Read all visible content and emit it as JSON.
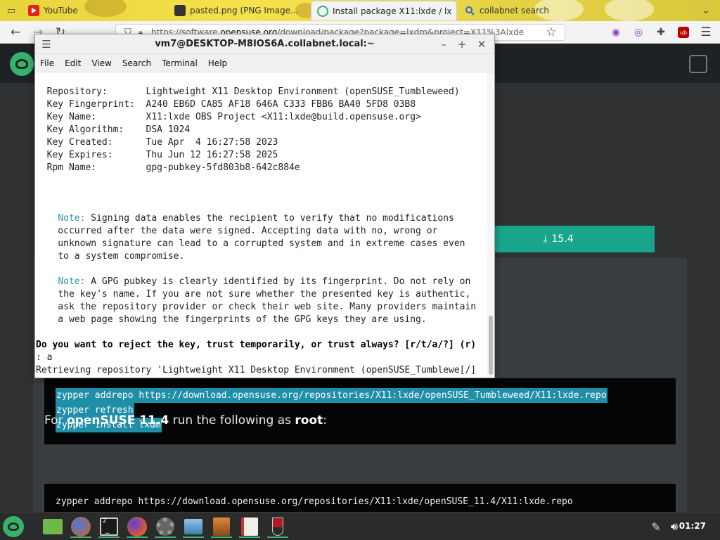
{
  "browser": {
    "tabs": [
      {
        "label": "YouTube",
        "icon": "youtube-icon"
      },
      {
        "label": "pasted.png (PNG Image...",
        "icon": "image-icon"
      },
      {
        "label": "Install package X11:lxde / lx",
        "icon": "opensuse-icon"
      },
      {
        "label": "collabnet search",
        "icon": "search-icon"
      }
    ],
    "url_prefix": "https://software.",
    "url_domain": "opensuse.org",
    "url_rest": "/download/package?package=lxdm&project=X11%3Alxde"
  },
  "site": {
    "download_label": "15.4",
    "code1": [
      "zypper addrepo https://download.opensuse.org/repositories/X11:lxde/openSUSE_Tumbleweed/X11:lxde.repo",
      "zypper refresh",
      "zypper install lxdm"
    ],
    "for_text_1": "For ",
    "for_text_2": "openSUSE 11.4",
    "for_text_3": " run the following as ",
    "for_text_4": "root",
    "for_text_5": ":",
    "code2": "zypper addrepo https://download.opensuse.org/repositories/X11:lxde/openSUSE_11.4/X11:lxde.repo"
  },
  "terminal": {
    "title": "vm7@DESKTOP-M8IOS6A.collabnet.local:~",
    "menu": [
      "File",
      "Edit",
      "View",
      "Search",
      "Terminal",
      "Help"
    ],
    "lines": {
      "l1": "  Repository:       Lightweight X11 Desktop Environment (openSUSE_Tumbleweed)",
      "l2": "  Key Fingerprint:  A240 EB6D CA85 AF18 646A C333 FBB6 BA40 5FD8 03B8",
      "l3": "  Key Name:         X11:lxde OBS Project <X11:lxde@build.opensuse.org>",
      "l4": "  Key Algorithm:    DSA 1024",
      "l5": "  Key Created:      Tue Apr  4 16:27:58 2023",
      "l6": "  Key Expires:      Thu Jun 12 16:27:58 2025",
      "l7": "  Rpm Name:         gpg-pubkey-5fd803b8-642c884e",
      "n1_label": "Note:",
      "n1_a": " Signing data enables the recipient to verify that no modifications",
      "n1_b": "    occurred after the data were signed. Accepting data with no, wrong or",
      "n1_c": "    unknown signature can lead to a corrupted system and in extreme cases even",
      "n1_d": "    to a system compromise.",
      "n2_label": "Note:",
      "n2_a": " A GPG pubkey is clearly identified by its fingerprint. Do not rely on",
      "n2_b": "    the key's name. If you are not sure whether the presented key is authentic,",
      "n2_c": "    ask the repository provider or check their web site. Many providers maintain",
      "n2_d": "    a web page showing the fingerprints of the GPG keys they are using.",
      "prompt": "Do you want to reject the key, trust temporarily, or trust always? [r/t/a/?] (r)",
      "answer": ": a",
      "retrieving": "Retrieving repository 'Lightweight X11 Desktop Environment (openSUSE_Tumblewe[/]"
    }
  },
  "taskbar": {
    "clock": "01:27",
    "workspace_badge": "2"
  }
}
